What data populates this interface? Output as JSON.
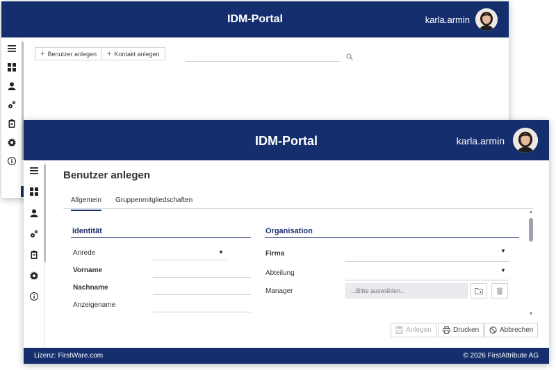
{
  "back_window": {
    "header": {
      "title": "IDM-Portal",
      "username": "karla.armin"
    },
    "toolbar": {
      "add_user_label": "Benutzer anlegen",
      "add_contact_label": "Kontakt anlegen",
      "search_placeholder": ""
    }
  },
  "front_window": {
    "header": {
      "title": "IDM-Portal",
      "username": "karla.armin"
    },
    "page_title": "Benutzer anlegen",
    "tabs": [
      {
        "label": "Allgemein",
        "active": true
      },
      {
        "label": "Gruppenmitgliedschaften",
        "active": false
      }
    ],
    "identity": {
      "heading": "Identität",
      "fields": [
        {
          "label": "Anrede",
          "value": "",
          "type": "select"
        },
        {
          "label": "Vorname",
          "value": "",
          "required": true
        },
        {
          "label": "Nachname",
          "value": "",
          "required": true
        },
        {
          "label": "Anzeigename",
          "value": ""
        }
      ]
    },
    "organisation": {
      "heading": "Organisation",
      "fields": [
        {
          "label": "Firma",
          "value": "",
          "type": "select",
          "required": true
        },
        {
          "label": "Abteilung",
          "value": "",
          "type": "select"
        },
        {
          "label": "Manager",
          "placeholder": "...Bitte auswählen..."
        }
      ]
    },
    "actions": {
      "create_label": "Anlegen",
      "print_label": "Drucken",
      "cancel_label": "Abbrechen"
    },
    "footer": {
      "license": "Lizenz: FirstWare.com",
      "copyright": "© 2026 FirstAttribute AG"
    }
  },
  "sidebar_icons": [
    "menu-icon",
    "dashboard-icon",
    "user-icon",
    "gears-icon",
    "clipboard-icon",
    "settings-icon",
    "info-icon"
  ],
  "colors": {
    "brand": "#152f6e",
    "accent_line": "#1f3170"
  }
}
